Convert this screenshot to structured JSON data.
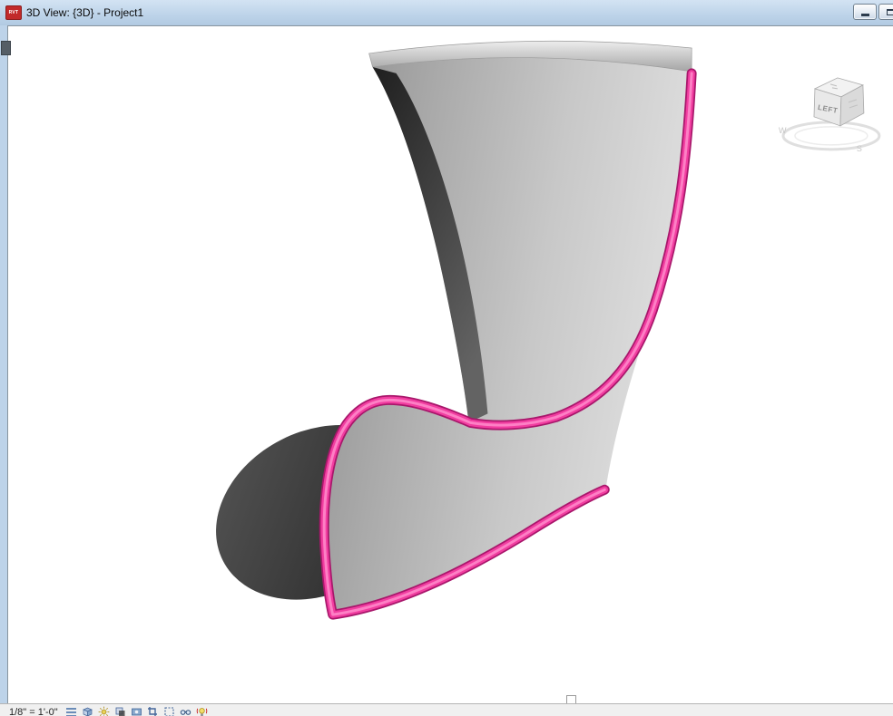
{
  "window": {
    "title": "3D View: {3D} - Project1",
    "icon_text": "RVT",
    "controls": {
      "minimize": "minimize",
      "maximize": "maximize"
    }
  },
  "viewcube": {
    "front_label": "LEFT",
    "compass_west": "W",
    "compass_south": "S"
  },
  "viewbar": {
    "scale": "1/8\" = 1'-0\"",
    "icons": [
      "Detail Level",
      "Visual Style",
      "Sun Path",
      "Shadows",
      "Show Rendering Dialog",
      "Crop View",
      "Show Crop Region",
      "Temporary Hide/Isolate",
      "Reveal Hidden Elements"
    ]
  },
  "colors": {
    "titlebar_bg": "#BDD3E9",
    "selection_pink": "#F13DA0",
    "statusbar_bg": "#F0F0F0",
    "surface_light": "#DCDCDC",
    "surface_mid": "#A0A0A0",
    "shadow_dark": "#2E2E2E"
  }
}
